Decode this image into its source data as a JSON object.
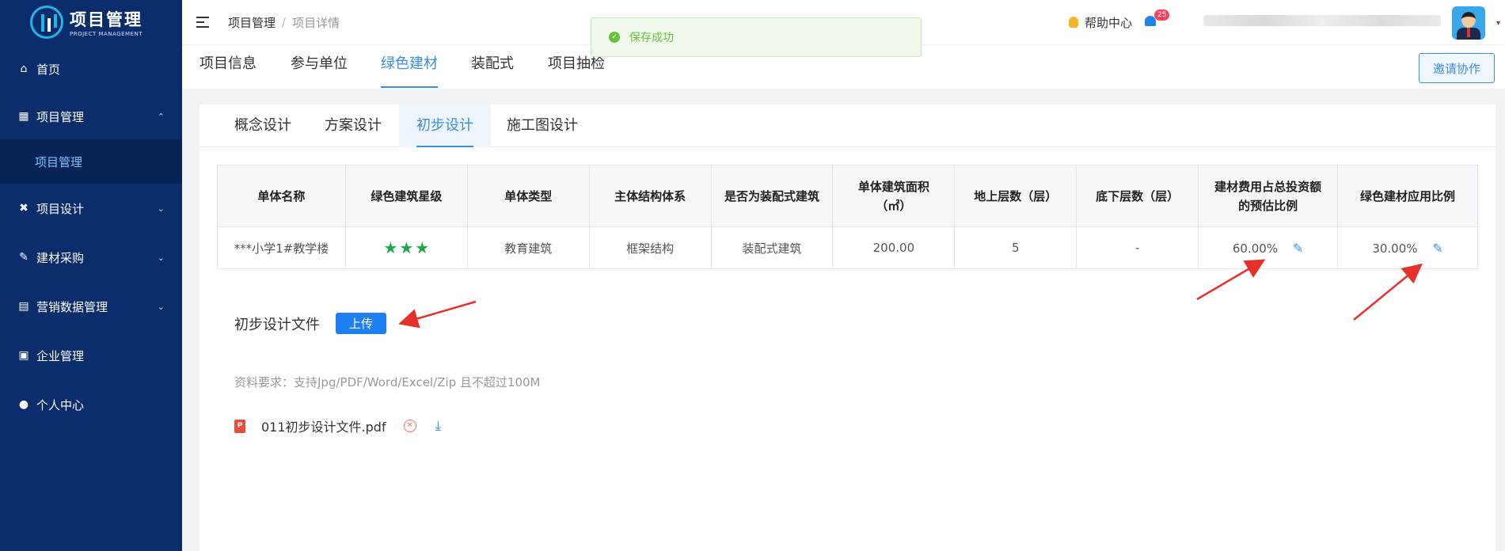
{
  "app": {
    "logo_title": "项目管理",
    "logo_subtitle": "PROJECT MANAGEMENT"
  },
  "sidebar": {
    "items": [
      {
        "label": "首页",
        "icon": "home-icon"
      },
      {
        "label": "项目管理",
        "icon": "book-icon",
        "expanded": true
      },
      {
        "label": "项目设计",
        "icon": "tools-icon"
      },
      {
        "label": "建材采购",
        "icon": "purchase-icon"
      },
      {
        "label": "营销数据管理",
        "icon": "chart-icon"
      },
      {
        "label": "企业管理",
        "icon": "building-icon"
      },
      {
        "label": "个人中心",
        "icon": "user-icon"
      }
    ],
    "submenu": {
      "label": "项目管理"
    },
    "colors": {
      "background": "#0b2d6b",
      "submenu_text": "#7fc1ff"
    }
  },
  "header": {
    "breadcrumb": [
      "项目管理",
      "项目详情"
    ],
    "breadcrumb_sep": "/",
    "help_label": "帮助中心",
    "notification_count": "25"
  },
  "toast": {
    "message": "保存成功",
    "type": "success",
    "icon": "check-circle-icon"
  },
  "top_tabs": {
    "items": [
      "项目信息",
      "参与单位",
      "绿色建材",
      "装配式",
      "项目抽检"
    ],
    "active": "绿色建材",
    "invite_label": "邀请协作"
  },
  "sub_tabs": {
    "items": [
      "概念设计",
      "方案设计",
      "初步设计",
      "施工图设计"
    ],
    "active": "初步设计"
  },
  "table": {
    "headers": [
      "单体名称",
      "绿色建筑星级",
      "单体类型",
      "主体结构体系",
      "是否为装配式建筑",
      "单体建筑面积\n（㎡）",
      "地上层数（层）",
      "底下层数（层）",
      "建材费用占总投资额\n的预估比例",
      "绿色建材应用比例"
    ],
    "rows": [
      {
        "name": "***小学1#教学楼",
        "star_count": 3,
        "type": "教育建筑",
        "structure": "框架结构",
        "prefab": "装配式建筑",
        "area": "200.00",
        "floors_above": "5",
        "floors_below": "-",
        "material_cost_ratio": "60.00%",
        "green_material_ratio": "30.00%"
      }
    ]
  },
  "upload_section": {
    "label": "初步设计文件",
    "button_label": "上传",
    "requirement": "资料要求：支持Jpg/PDF/Word/Excel/Zip 且不超过100M",
    "files": [
      {
        "name": "011初步设计文件.pdf",
        "icon": "pdf-icon"
      }
    ]
  },
  "colors": {
    "accent": "#3a8ee6",
    "success": "#67c23a",
    "star": "#19a84a",
    "annotation_arrow": "#e8302a"
  }
}
